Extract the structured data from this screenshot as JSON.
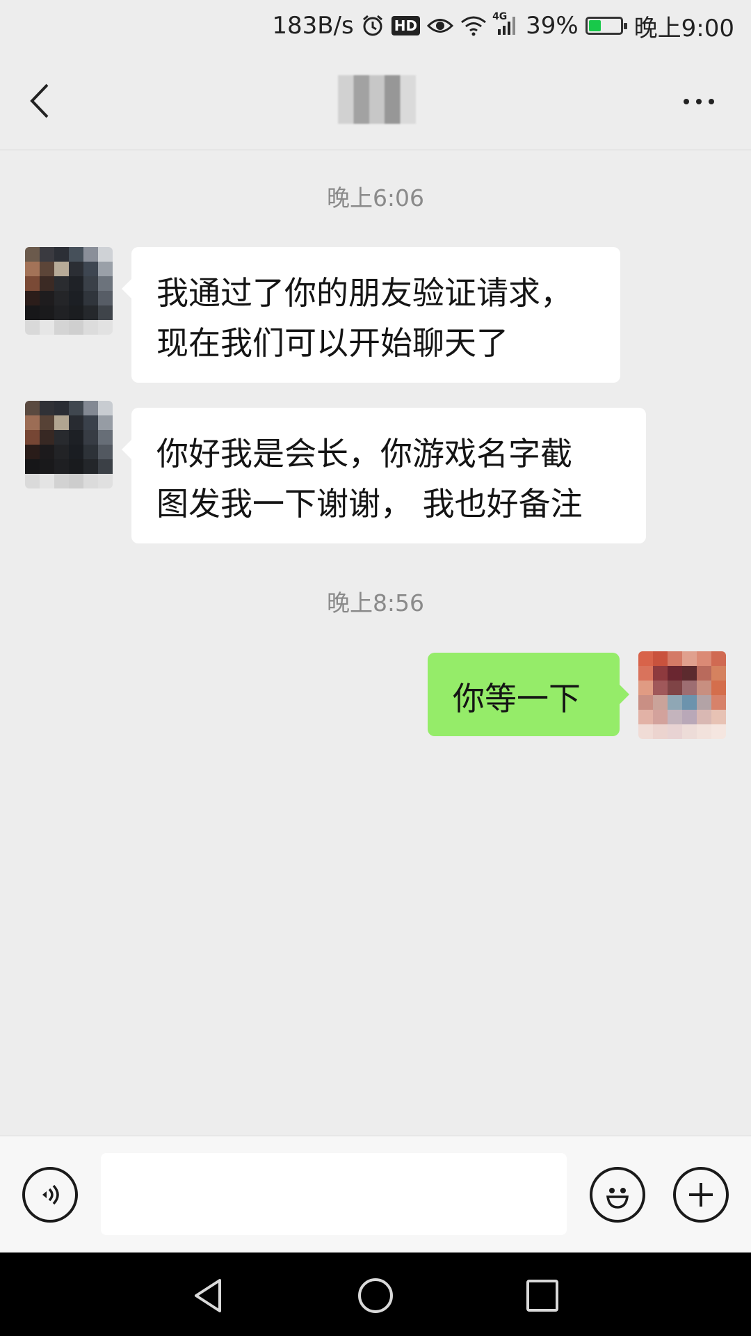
{
  "status_bar": {
    "net_speed": "183B/s",
    "hd_badge": "HD",
    "network_type": "4G",
    "battery_percent": "39%",
    "battery_level": 0.39,
    "time": "晚上9:00"
  },
  "header": {
    "back_icon": "chevron-left-icon",
    "more_icon": "more-horizontal-icon"
  },
  "messages": [
    {
      "kind": "time",
      "text": "晚上6:06"
    },
    {
      "kind": "incoming",
      "lines": [
        "我通过了你的朋友验证请求，",
        "现在我们可以开始聊天了"
      ]
    },
    {
      "kind": "incoming",
      "lines": [
        "你好我是会长，你游戏名字截",
        "图发我一下谢谢， 我也好备注"
      ]
    },
    {
      "kind": "time",
      "text": "晚上8:56"
    },
    {
      "kind": "outgoing",
      "lines": [
        "你等一下"
      ]
    }
  ],
  "input_bar": {
    "voice_icon": "voice-icon",
    "emoji_icon": "emoji-icon",
    "plus_icon": "plus-icon",
    "input_value": ""
  },
  "system_nav": {
    "back_icon": "triangle-back-icon",
    "home_icon": "circle-home-icon",
    "recents_icon": "square-recents-icon"
  },
  "colors": {
    "background": "#ededed",
    "outgoing_bubble": "#95ec69",
    "incoming_bubble": "#ffffff",
    "battery_fill": "#18c94a"
  }
}
